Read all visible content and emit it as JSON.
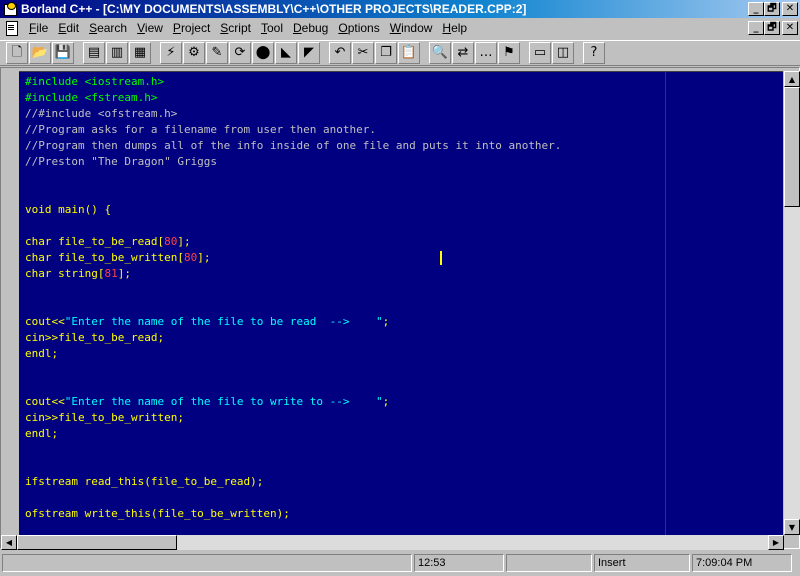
{
  "window": {
    "title": "Borland C++ - [C:\\MY DOCUMENTS\\ASSEMBLY\\C++\\OTHER PROJECTS\\READER.CPP:2]",
    "minimize_glyph": "_",
    "maximize_glyph": "🗗",
    "close_glyph": "✕"
  },
  "menu": {
    "items": [
      {
        "underline": "F",
        "rest": "ile"
      },
      {
        "underline": "E",
        "rest": "dit"
      },
      {
        "underline": "S",
        "rest": "earch"
      },
      {
        "underline": "V",
        "rest": "iew"
      },
      {
        "underline": "P",
        "rest": "roject"
      },
      {
        "underline": "S",
        "rest": "cript"
      },
      {
        "underline": "T",
        "rest": "ool"
      },
      {
        "underline": "D",
        "rest": "ebug"
      },
      {
        "underline": "O",
        "rest": "ptions"
      },
      {
        "underline": "W",
        "rest": "indow"
      },
      {
        "underline": "H",
        "rest": "elp"
      }
    ]
  },
  "toolbar": {
    "buttons": [
      {
        "name": "new-file",
        "glyph": "🗋"
      },
      {
        "name": "open-file",
        "glyph": "📂"
      },
      {
        "name": "save-file",
        "glyph": "💾"
      },
      {
        "name": "gap"
      },
      {
        "name": "open-project",
        "glyph": "▤"
      },
      {
        "name": "save-project",
        "glyph": "▥"
      },
      {
        "name": "project-manager",
        "glyph": "▦"
      },
      {
        "name": "gap"
      },
      {
        "name": "make",
        "glyph": "⚡"
      },
      {
        "name": "build-all",
        "glyph": "⚙"
      },
      {
        "name": "compile",
        "glyph": "✎"
      },
      {
        "name": "run",
        "glyph": "⟳"
      },
      {
        "name": "stop",
        "glyph": "⬤"
      },
      {
        "name": "step-over",
        "glyph": "◣"
      },
      {
        "name": "trace-into",
        "glyph": "◤"
      },
      {
        "name": "gap"
      },
      {
        "name": "undo",
        "glyph": "↶"
      },
      {
        "name": "cut",
        "glyph": "✂"
      },
      {
        "name": "copy",
        "glyph": "❐"
      },
      {
        "name": "paste",
        "glyph": "📋"
      },
      {
        "name": "gap"
      },
      {
        "name": "find",
        "glyph": "🔍"
      },
      {
        "name": "replace",
        "glyph": "⇄"
      },
      {
        "name": "search-again",
        "glyph": "…"
      },
      {
        "name": "browse-symbol",
        "glyph": "⚑"
      },
      {
        "name": "gap"
      },
      {
        "name": "view-classes",
        "glyph": "▭"
      },
      {
        "name": "view-globals",
        "glyph": "◫"
      },
      {
        "name": "gap"
      },
      {
        "name": "help-pointer",
        "glyph": "?"
      }
    ]
  },
  "code": {
    "lines": [
      [
        {
          "t": "#include <iostream.h>",
          "c": "pre"
        }
      ],
      [
        {
          "t": "#include <fstream.h>",
          "c": "pre"
        }
      ],
      [
        {
          "t": "//#include <ofstream.h>",
          "c": "cmt"
        }
      ],
      [
        {
          "t": "//Program asks for a filename from user then another.",
          "c": "cmt"
        }
      ],
      [
        {
          "t": "//Program then dumps all of the info inside of one file and puts it into another.",
          "c": "cmt"
        }
      ],
      [
        {
          "t": "//Preston \"The Dragon\" Griggs",
          "c": "cmt"
        }
      ],
      [],
      [],
      [
        {
          "t": "void main() {",
          "c": "kw"
        }
      ],
      [],
      [
        {
          "t": "char file_to_be_read[",
          "c": "id"
        },
        {
          "t": "80",
          "c": "num"
        },
        {
          "t": "];",
          "c": "id"
        }
      ],
      [
        {
          "t": "char file_to_be_written[",
          "c": "id"
        },
        {
          "t": "80",
          "c": "num"
        },
        {
          "t": "];",
          "c": "id"
        }
      ],
      [
        {
          "t": "char string[",
          "c": "id"
        },
        {
          "t": "81",
          "c": "num"
        },
        {
          "t": "];",
          "c": "id"
        }
      ],
      [],
      [],
      [
        {
          "t": "cout<<",
          "c": "id"
        },
        {
          "t": "\"Enter the name of the file to be read  -->    \"",
          "c": "str"
        },
        {
          "t": ";",
          "c": "id"
        }
      ],
      [
        {
          "t": "cin>>file_to_be_read;",
          "c": "id"
        }
      ],
      [
        {
          "t": "endl;",
          "c": "id"
        }
      ],
      [],
      [],
      [
        {
          "t": "cout<<",
          "c": "id"
        },
        {
          "t": "\"Enter the name of the file to write to -->    \"",
          "c": "str"
        },
        {
          "t": ";",
          "c": "id"
        }
      ],
      [
        {
          "t": "cin>>file_to_be_written;",
          "c": "id"
        }
      ],
      [
        {
          "t": "endl;",
          "c": "id"
        }
      ],
      [],
      [],
      [
        {
          "t": "ifstream read_this(file_to_be_read);",
          "c": "id"
        }
      ],
      [],
      [
        {
          "t": "ofstream write_this(file_to_be_written);",
          "c": "id"
        }
      ]
    ]
  },
  "status": {
    "message": "",
    "position": "12:53",
    "modified": "",
    "mode": "Insert",
    "time": "7:09:04 PM"
  },
  "scrollbar": {
    "up_glyph": "▲",
    "down_glyph": "▼",
    "left_glyph": "◀",
    "right_glyph": "▶"
  }
}
